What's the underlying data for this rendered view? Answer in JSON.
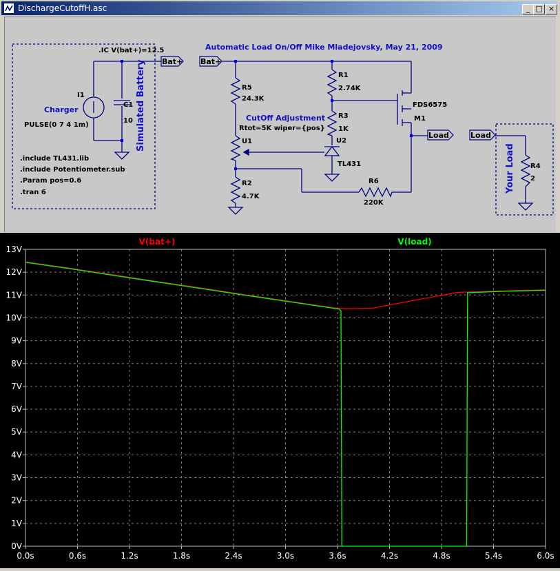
{
  "window": {
    "title": "DischargeCutoffH.asc"
  },
  "window_controls": {
    "minimize": "_",
    "maximize": "□",
    "close": "×"
  },
  "schematic": {
    "header": "Automatic Load On/Off   Mike Mladejovsky, May 21, 2009",
    "ic_directive": ".IC V(bat+)=12.5",
    "battery_label": "Simulated Battery",
    "load_label": "Your Load",
    "charger": {
      "ref": "I1",
      "name": "Charger",
      "value": "PULSE(0 7 4 1m)"
    },
    "capacitor": {
      "ref": "C1",
      "value": "10"
    },
    "resistors": [
      {
        "ref": "R5",
        "value": "24.3K"
      },
      {
        "ref": "R1",
        "value": "2.74K"
      },
      {
        "ref": "R3",
        "value": "1K"
      },
      {
        "ref": "R2",
        "value": "4.7K"
      },
      {
        "ref": "R6",
        "value": "220K"
      },
      {
        "ref": "R4",
        "value": "2"
      }
    ],
    "potentiometer": {
      "ref": "U1",
      "title": "CutOff Adjustment",
      "params": "Rtot=5K wiper={pos}"
    },
    "shunt_reg": {
      "ref": "U2",
      "value": "TL431"
    },
    "mosfet": {
      "ref": "M1",
      "value": "FDS6575"
    },
    "net_labels": {
      "bat_left": "Bat+",
      "bat_right": "Bat+",
      "load_out": "Load",
      "load_in": "Load"
    },
    "directives": [
      ".include TL431.lib",
      ".include Potentiometer.sub",
      ".Param pos=0.6",
      ".tran 6"
    ]
  },
  "chart_data": {
    "type": "line",
    "title": "",
    "xlabel": "",
    "ylabel": "",
    "xlim": [
      0,
      6
    ],
    "ylim": [
      0,
      13
    ],
    "x_ticks": [
      "0.0s",
      "0.6s",
      "1.2s",
      "1.8s",
      "2.4s",
      "3.0s",
      "3.6s",
      "4.2s",
      "4.8s",
      "5.4s",
      "6.0s"
    ],
    "y_ticks": [
      "0V",
      "1V",
      "2V",
      "3V",
      "4V",
      "5V",
      "6V",
      "7V",
      "8V",
      "9V",
      "10V",
      "11V",
      "12V",
      "13V"
    ],
    "grid": true,
    "background": "#000000",
    "series": [
      {
        "name": "V(bat+)",
        "color": "#ff0000",
        "x": [
          0,
          0.5,
          1.0,
          1.5,
          2.0,
          2.5,
          3.0,
          3.5,
          3.6,
          3.7,
          4.0,
          4.5,
          5.0,
          5.1,
          5.5,
          6.0
        ],
        "y": [
          12.45,
          12.18,
          11.89,
          11.6,
          11.32,
          11.03,
          10.75,
          10.47,
          10.42,
          10.4,
          10.42,
          10.78,
          11.12,
          11.13,
          11.18,
          11.23
        ]
      },
      {
        "name": "V(load)",
        "color": "#00ff00",
        "x": [
          0,
          0.5,
          1.0,
          1.5,
          2.0,
          2.5,
          3.0,
          3.5,
          3.62,
          3.64,
          3.65,
          5.09,
          5.1,
          5.5,
          6.0
        ],
        "y": [
          12.43,
          12.16,
          11.87,
          11.58,
          11.3,
          11.01,
          10.73,
          10.45,
          10.38,
          10.3,
          0,
          0,
          11.1,
          11.16,
          11.21
        ]
      }
    ]
  },
  "colors": {
    "schematic_bg": "#c8c8c8",
    "wire": "#000080",
    "text": "#0000c0",
    "plot_bg": "#000000",
    "grid": "#808080"
  }
}
